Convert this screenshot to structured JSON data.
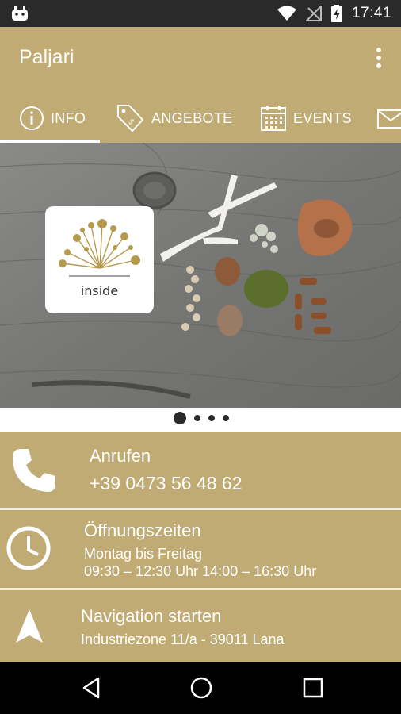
{
  "status_bar": {
    "time": "17:41"
  },
  "app": {
    "title": "Paljari"
  },
  "tabs": [
    {
      "label": "INFO",
      "icon": "info-icon",
      "selected": true
    },
    {
      "label": "ANGEBOTE",
      "icon": "price-tag-icon",
      "selected": false
    },
    {
      "label": "EVENTS",
      "icon": "calendar-icon",
      "selected": false
    },
    {
      "label": "",
      "icon": "mail-icon",
      "selected": false
    }
  ],
  "hero": {
    "logo_text": "inside",
    "pager": {
      "pages": 4,
      "active": 1
    }
  },
  "contact": {
    "call": {
      "title": "Anrufen",
      "phone": "+39 0473 56 48 62",
      "icon": "phone-icon"
    },
    "hours": {
      "title": "Öffnungszeiten",
      "days": "Montag bis Freitag",
      "times": "09:30 – 12:30 Uhr 14:00 – 16:30 Uhr",
      "icon": "clock-icon"
    },
    "navigation": {
      "title": "Navigation starten",
      "address": "Industriezone 11/a - 39011 Lana",
      "icon": "navigation-arrow-icon"
    }
  },
  "colors": {
    "primary": "#bfab73",
    "status_bar": "#2a2a2a",
    "separator": "#f0ebdd",
    "nav_bar": "#000000"
  }
}
